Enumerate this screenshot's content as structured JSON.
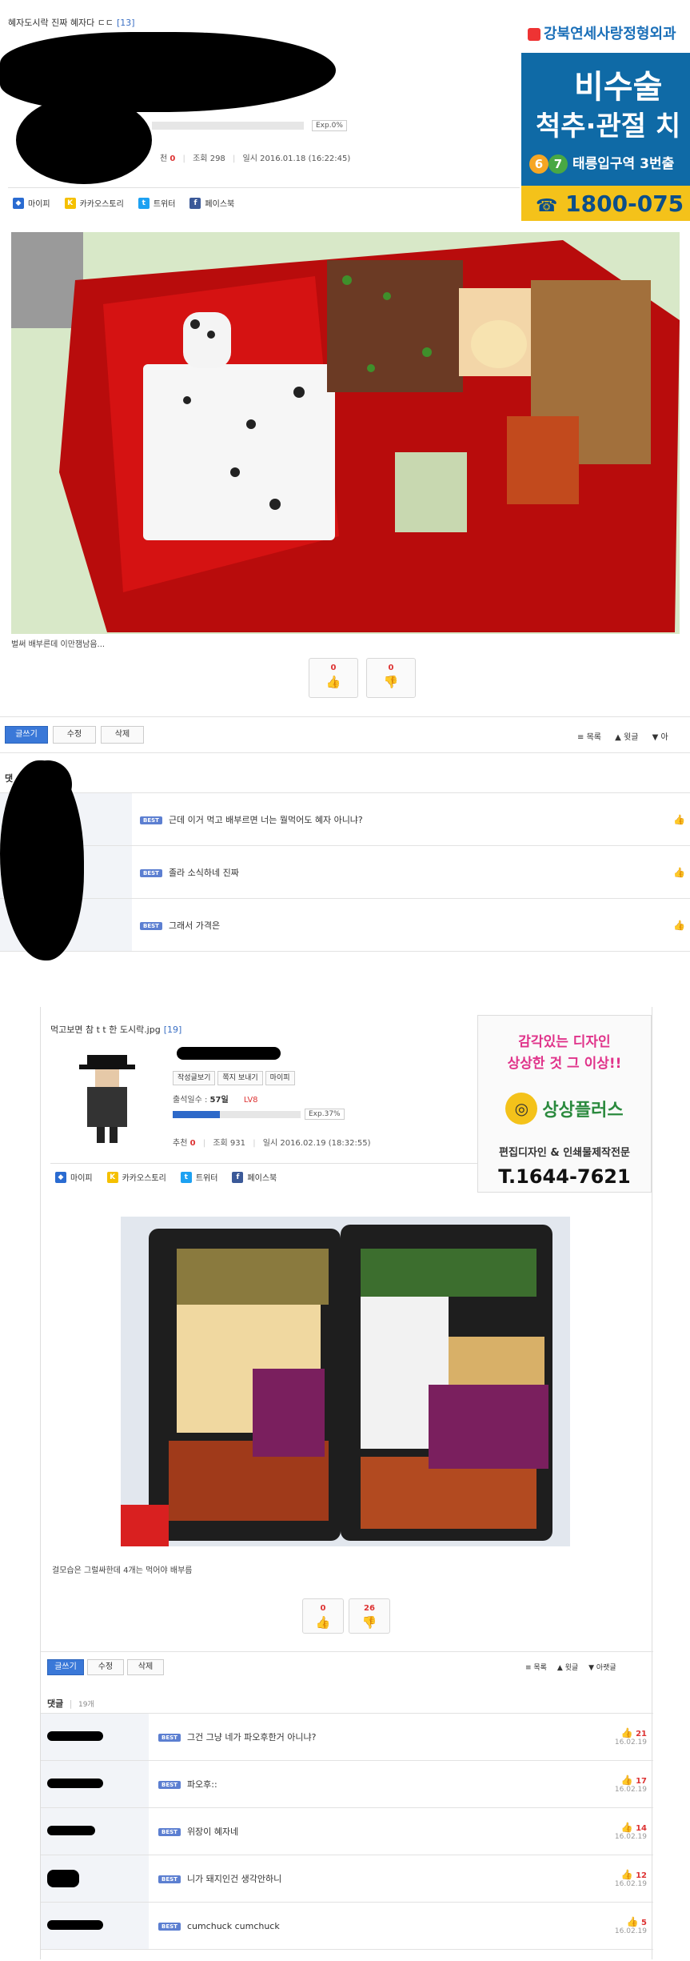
{
  "post1": {
    "title": "혜자도시락 진짜 혜자다 ㄷㄷ",
    "comment_count": "[13]",
    "exp": "Exp.0%",
    "recommend_label": "천",
    "recommend_value": "0",
    "views_label": "조회",
    "views_value": "298",
    "date_label": "일시",
    "date_value": "2016.01.18 (16:22:45)",
    "share": [
      "마이피",
      "카카오스토리",
      "트위터",
      "페이스북"
    ],
    "caption": "벌써 배부른데 이만잼남음...",
    "votes": {
      "up": "0",
      "down": "0"
    },
    "buttons": {
      "write": "글쓰기",
      "edit": "수정",
      "delete": "삭제"
    },
    "nav": {
      "list": "목록",
      "reply": "윗글",
      "next": "아"
    },
    "comments_label": "댓",
    "comments": [
      {
        "badge": "BEST",
        "text": "근데 이거 먹고 배부르면 너는 뭘먹어도 혜자 아니냐?"
      },
      {
        "badge": "BEST",
        "text": "졸라 소식하네 진짜"
      },
      {
        "badge": "BEST",
        "text": "그래서 가격은"
      }
    ],
    "ad": {
      "brand": "강북연세사랑정형외과",
      "line1": "비수술",
      "line2": "척추·관절 치",
      "badge_a": "6",
      "badge_b": "7",
      "line3": "태릉입구역 3번출",
      "phone": "1800-075"
    }
  },
  "post2": {
    "title": "먹고보면 참 t t 한 도시락.jpg",
    "comment_count": "[19]",
    "buttons_small": [
      "작성글보기",
      "쪽지 보내기",
      "마이피"
    ],
    "attendance_label": "출석일수 :",
    "attendance_value": "57일",
    "level": "LV8",
    "exp": "Exp.37%",
    "exp_fraction": 0.37,
    "recommend_label": "추천",
    "recommend_value": "0",
    "views_label": "조회",
    "views_value": "931",
    "date_label": "일시",
    "date_value": "2016.02.19 (18:32:55)",
    "share": [
      "마이피",
      "카카오스토리",
      "트위터",
      "페이스북"
    ],
    "caption": "걸모습은 그럴싸한데 4개는 먹어야 배부름",
    "votes": {
      "up": "0",
      "down": "26"
    },
    "buttons": {
      "write": "글쓰기",
      "edit": "수정",
      "delete": "삭제"
    },
    "nav": {
      "list": "목록",
      "reply": "윗글",
      "next": "아랫글"
    },
    "comments_label": "댓글",
    "comments_count": "19개",
    "comments": [
      {
        "badge": "BEST",
        "text": "그건 그냥 네가 파오후한거 아니냐?",
        "likes": "21",
        "date": "16.02.19"
      },
      {
        "badge": "BEST",
        "text": "파오후::",
        "likes": "17",
        "date": "16.02.19"
      },
      {
        "badge": "BEST",
        "text": "위장이 혜자네",
        "likes": "14",
        "date": "16.02.19"
      },
      {
        "badge": "BEST",
        "text": "니가 돼지인건 생각안하니",
        "likes": "12",
        "date": "16.02.19"
      },
      {
        "badge": "BEST",
        "text": "cumchuck cumchuck",
        "likes": "5",
        "date": "16.02.19"
      }
    ],
    "ad": {
      "line1": "감각있는 디자인",
      "line2": "상상한 것 그 이상!!",
      "brand": "상상플러스",
      "line3": "편집디자인 & 인쇄물제작전문",
      "phone": "T.1644-7621"
    }
  }
}
